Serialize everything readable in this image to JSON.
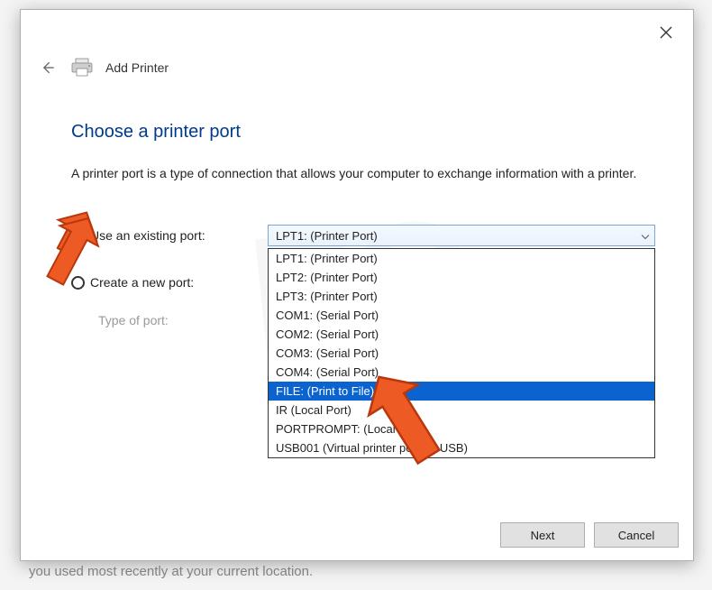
{
  "header": {
    "title": "Add Printer"
  },
  "page": {
    "heading": "Choose a printer port",
    "description": "A printer port is a type of connection that allows your computer to exchange information with a printer."
  },
  "form": {
    "option_existing": {
      "label": "Use an existing port:",
      "selected": true,
      "combo_value": "LPT1: (Printer Port)"
    },
    "option_create": {
      "label": "Create a new port:",
      "selected": false
    },
    "type_of_port": {
      "label": "Type of port:",
      "combo_value": ""
    },
    "port_options": [
      "LPT1: (Printer Port)",
      "LPT2: (Printer Port)",
      "LPT3: (Printer Port)",
      "COM1: (Serial Port)",
      "COM2: (Serial Port)",
      "COM3: (Serial Port)",
      "COM4: (Serial Port)",
      "FILE: (Print to File)",
      "IR (Local Port)",
      "PORTPROMPT: (Local Port)",
      "USB001 (Virtual printer port for USB)"
    ],
    "highlighted_option_index": 7
  },
  "buttons": {
    "next": "Next",
    "cancel": "Cancel"
  },
  "footer": {
    "text": "you used most recently at your current location."
  },
  "annotations": {
    "arrow1_target": "use-existing-port-radio",
    "arrow2_target": "port-option-file"
  },
  "colors": {
    "accent": "#003a8c",
    "highlight": "#0a63cf",
    "arrow": "#ee5a24"
  }
}
